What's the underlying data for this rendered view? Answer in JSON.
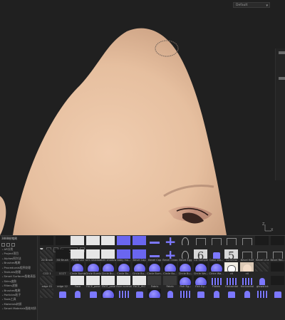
{
  "viewport": {
    "view_mode": "Default"
  },
  "panel": {
    "title": "3888粉笔刷",
    "sidebar_items": [
      "AR分类",
      "Project项目",
      "Alphas阿尔法",
      "Brushes笔刷",
      "Procedurals程序纹理",
      "Textures纹理",
      "Smart Surfaces智能表面",
      "Skins皮肤",
      "Filters滤镜",
      "Brushes笔刷",
      "Particles粒子",
      "Tools工具",
      "Materials材质",
      "Smart Materials智能材质"
    ],
    "search_placeholder": "Search...",
    "tiles": [
      {
        "label": "",
        "thumb": "dark"
      },
      {
        "label": "",
        "thumb": "dark"
      },
      {
        "label": "",
        "thumb": "light"
      },
      {
        "label": "",
        "thumb": "light"
      },
      {
        "label": "",
        "thumb": "light"
      },
      {
        "label": "",
        "thumb": "blue"
      },
      {
        "label": "",
        "thumb": "blue"
      },
      {
        "label": "",
        "thumb": "dash"
      },
      {
        "label": "",
        "thumb": "cross"
      },
      {
        "label": "",
        "thumb": "egg"
      },
      {
        "label": "",
        "thumb": "square"
      },
      {
        "label": "",
        "thumb": "square"
      },
      {
        "label": "",
        "thumb": "square"
      },
      {
        "label": "",
        "thumb": "square"
      },
      {
        "label": "",
        "thumb": "dark"
      },
      {
        "label": "",
        "thumb": "dark"
      },
      {
        "label": "2D Brush",
        "thumb": "noise"
      },
      {
        "label": "3D Brush",
        "thumb": "dark"
      },
      {
        "label": "Pinkbrush",
        "thumb": "light"
      },
      {
        "label": "arm shadow",
        "thumb": "light"
      },
      {
        "label": "arm shadow",
        "thumb": "light"
      },
      {
        "label": "baby mo...",
        "thumb": "blue"
      },
      {
        "label": "Bevel Cap",
        "thumb": "blue"
      },
      {
        "label": "Bevel Cap",
        "thumb": "dash"
      },
      {
        "label": "Bevel Cross",
        "thumb": "cross"
      },
      {
        "label": "Bevel Egg",
        "thumb": "egg"
      },
      {
        "label": "CD Sample",
        "thumb": "num",
        "num": "6"
      },
      {
        "label": "Color Wa...",
        "thumb": "cup"
      },
      {
        "label": "Corrector",
        "thumb": "num",
        "num": "5"
      },
      {
        "label": "Bevel Half",
        "thumb": "square"
      },
      {
        "label": "Bevel Line",
        "thumb": "square"
      },
      {
        "label": "Bevel Rec...",
        "thumb": "square"
      },
      {
        "label": "CCD 1",
        "thumb": "noise"
      },
      {
        "label": "CCCT",
        "thumb": "dark"
      },
      {
        "label": "Circle Bumb",
        "thumb": "circle"
      },
      {
        "label": "Circle Bumb",
        "thumb": "circle"
      },
      {
        "label": "Circle Bu...",
        "thumb": "circle"
      },
      {
        "label": "Circle Bu...",
        "thumb": "circle"
      },
      {
        "label": "Circle Bu...",
        "thumb": "circle"
      },
      {
        "label": "Circle Bum...",
        "thumb": "circle"
      },
      {
        "label": "Circle Bu...",
        "thumb": "circle"
      },
      {
        "label": "Circle Bu...",
        "thumb": "circle"
      },
      {
        "label": "Circle Wa...",
        "thumb": "circle"
      },
      {
        "label": "Cirlce Wa...",
        "thumb": "circle"
      },
      {
        "label": "ctl",
        "thumb": "cat"
      },
      {
        "label": "ctl",
        "thumb": "face"
      },
      {
        "label": "",
        "thumb": "noise"
      },
      {
        "label": "",
        "thumb": "dark"
      },
      {
        "label": "edge 01",
        "thumb": "noise"
      },
      {
        "label": "edge 12",
        "thumb": "dark"
      },
      {
        "label": "Face",
        "thumb": "light"
      },
      {
        "label": "FACE_pose",
        "thumb": "light"
      },
      {
        "label": "FACE_pose",
        "thumb": "light"
      },
      {
        "label": "face normal",
        "thumb": "light"
      },
      {
        "label": "FACE_WG",
        "thumb": "light"
      },
      {
        "label": "Fabric",
        "thumb": "grey"
      },
      {
        "label": "Fabric",
        "thumb": "grey"
      },
      {
        "label": "Fish Eg...",
        "thumb": "circle"
      },
      {
        "label": "Fish Eg...",
        "thumb": "circle"
      },
      {
        "label": "Flakes",
        "thumb": "bars"
      },
      {
        "label": "Horizontal",
        "thumb": "bars"
      },
      {
        "label": "Horizontal",
        "thumb": "bars"
      },
      {
        "label": "glowstick",
        "thumb": "pill"
      },
      {
        "label": "",
        "thumb": "dark"
      },
      {
        "label": "",
        "thumb": "noise"
      },
      {
        "label": "",
        "thumb": "cup"
      },
      {
        "label": "",
        "thumb": "pill"
      },
      {
        "label": "",
        "thumb": "cup"
      },
      {
        "label": "",
        "thumb": "circle"
      },
      {
        "label": "",
        "thumb": "bars"
      },
      {
        "label": "",
        "thumb": "cup"
      },
      {
        "label": "",
        "thumb": "circle"
      },
      {
        "label": "",
        "thumb": "pill"
      },
      {
        "label": "",
        "thumb": "bars"
      },
      {
        "label": "",
        "thumb": "cup"
      },
      {
        "label": "",
        "thumb": "pill"
      },
      {
        "label": "",
        "thumb": "cup"
      },
      {
        "label": "",
        "thumb": "pill"
      },
      {
        "label": "",
        "thumb": "bars"
      },
      {
        "label": "",
        "thumb": "cup"
      }
    ]
  },
  "colors": {
    "skin": "#ebc6a6",
    "brush_accent": "#6a66f0",
    "panel_bg": "#262626"
  },
  "gizmo": {
    "z_label": "Z",
    "x_label": "X"
  }
}
